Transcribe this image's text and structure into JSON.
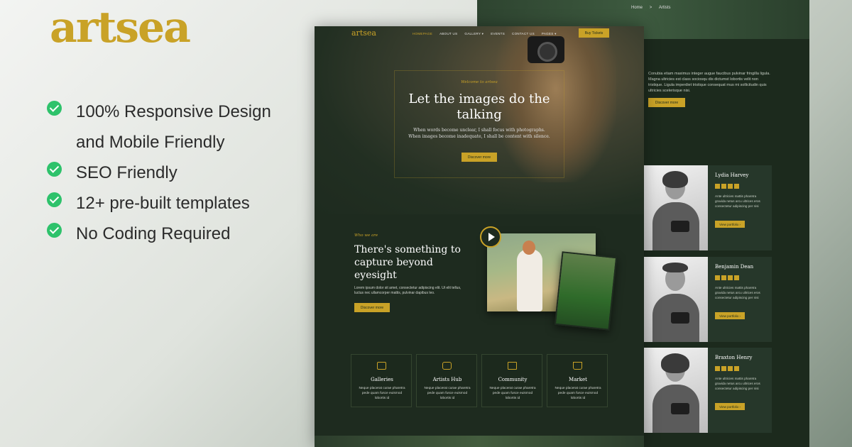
{
  "promo": {
    "logo": "artsea",
    "features": [
      "100% Responsive Design",
      "and Mobile Friendly",
      "SEO Friendly",
      "12+ pre-built templates",
      "No Coding Required"
    ]
  },
  "mockup": {
    "logo": "artsea",
    "nav": [
      "HOMEPAGE",
      "ABOUT US",
      "GALLERY ▾",
      "EVENTS",
      "CONTACT US",
      "PAGES ▾"
    ],
    "buy_label": "Buy Tickets",
    "hero": {
      "kicker": "Welcome to artsea",
      "title": "Let the images do the talking",
      "subtitle": "When words become unclear, I shall focus with photographs. When images become inadequate, I shall be content with silence.",
      "button": "Discover more"
    },
    "who": {
      "kicker": "Who we are",
      "title": "There's something to capture beyond eyesight",
      "text": "Lorem ipsum dolor sit amet, consectetur adipiscing elit. Ut elit tellus, luctus nec ullamcorper mattis, pulvinar dapibus leo.",
      "button": "Discover more"
    },
    "feature_cards": [
      {
        "title": "Galleries",
        "text": "Neque placerat curae pharetra pede quam fusce euismod lobortis id",
        "icon": "gallery-icon"
      },
      {
        "title": "Artists Hub",
        "text": "Neque placerat curae pharetra pede quam fusce euismod lobortis id",
        "icon": "camera-icon"
      },
      {
        "title": "Community",
        "text": "Neque placerat curae pharetra pede quam fusce euismod lobortis id",
        "icon": "community-icon"
      },
      {
        "title": "Market",
        "text": "Neque placerat curae pharetra pede quam fusce euismod lobortis id",
        "icon": "cart-icon"
      }
    ]
  },
  "background_page": {
    "breadcrumb_home": "Home",
    "breadcrumb_sep": ">",
    "breadcrumb_current": "Artists",
    "about_text": "Conubia etiam maximus integer augue faucibus pulvinar fringilla ligula. Magna ultricies est class sociosqu dis dictumst lobortis velit non tristique. Ligula imperdiet tristique consequat mus mi sollicitudin quis ultricies scelerisque nisi.",
    "about_button": "Discover more",
    "artists": [
      {
        "name": "Lydia Harvey",
        "bio": "Ante ultricies mattis pharetra gravida netus arcu ultrices eros consectetur adipiscing per nisi",
        "button": "View portfolio  ›"
      },
      {
        "name": "Benjamin Dean",
        "bio": "Ante ultricies mattis pharetra gravida netus arcu ultrices eros consectetur adipiscing per nisi",
        "button": "View portfolio  ›"
      },
      {
        "name": "Braxton Henry",
        "bio": "Ante ultricies mattis pharetra gravida netus arcu ultrices eros consectetur adipiscing per nisi",
        "button": "View portfolio  ›"
      }
    ]
  },
  "colors": {
    "accent": "#c9a227",
    "check": "#2ec26b",
    "dark_bg": "#1e2b1f"
  }
}
